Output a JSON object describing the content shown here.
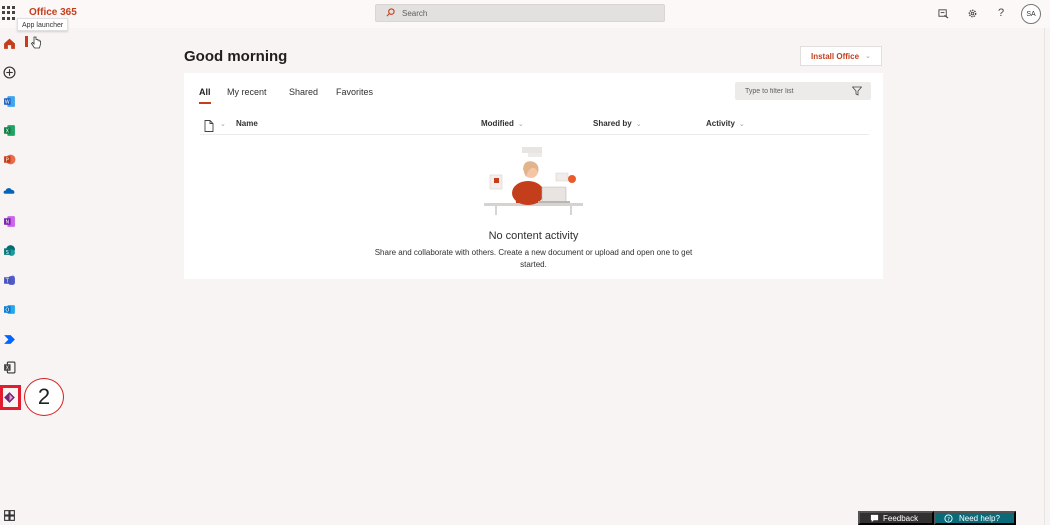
{
  "app": {
    "brand": "Office 365",
    "tooltip": "App launcher",
    "user_initials": "SA"
  },
  "search": {
    "placeholder": "Search"
  },
  "main": {
    "greeting": "Good morning",
    "install_label": "Install Office",
    "tabs": [
      {
        "label": "All",
        "active": true
      },
      {
        "label": "My recent",
        "active": false
      },
      {
        "label": "Shared",
        "active": false
      },
      {
        "label": "Favorites",
        "active": false
      }
    ],
    "filter_placeholder": "Type to filter list",
    "columns": [
      "Name",
      "Modified",
      "Shared by",
      "Activity"
    ],
    "empty_title": "No content activity",
    "empty_desc": "Share and collaborate with others. Create a new document or upload and open one to get started."
  },
  "annotation": {
    "step": "2"
  },
  "footer": {
    "feedback": "Feedback",
    "help": "Need help?"
  },
  "colors": {
    "accent": "#c43e1c",
    "highlight": "#e21e2e",
    "help_bg": "#0b6a78"
  }
}
